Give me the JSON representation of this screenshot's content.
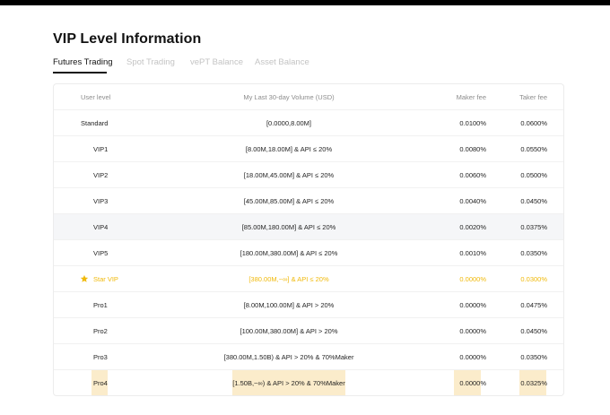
{
  "page": {
    "title": "VIP Level Information"
  },
  "tabs": [
    {
      "label": "Futures Trading",
      "active": true
    },
    {
      "label": "Spot Trading",
      "active": false
    },
    {
      "label": "vePT Balance",
      "active": false
    },
    {
      "label": "Asset Balance",
      "active": false
    }
  ],
  "table": {
    "headers": {
      "level": "User level",
      "volume": "My Last 30-day Volume (USD)",
      "maker": "Maker fee",
      "taker": "Taker fee"
    },
    "rows": [
      {
        "level": "Standard",
        "volume": "[0.0000,8.00M]",
        "maker": "0.0100%",
        "taker": "0.0600%"
      },
      {
        "level": "VIP1",
        "volume": "[8.00M,18.00M] & API ≤ 20%",
        "maker": "0.0080%",
        "taker": "0.0550%"
      },
      {
        "level": "VIP2",
        "volume": "[18.00M,45.00M] & API ≤ 20%",
        "maker": "0.0060%",
        "taker": "0.0500%"
      },
      {
        "level": "VIP3",
        "volume": "[45.00M,85.00M] & API ≤ 20%",
        "maker": "0.0040%",
        "taker": "0.0450%"
      },
      {
        "level": "VIP4",
        "volume": "[85.00M,180.00M] & API ≤ 20%",
        "maker": "0.0020%",
        "taker": "0.0375%"
      },
      {
        "level": "VIP5",
        "volume": "[180.00M,380.00M] & API ≤ 20%",
        "maker": "0.0010%",
        "taker": "0.0350%"
      },
      {
        "level": "Star VIP",
        "volume": "[380.00M,~∞] & API ≤ 20%",
        "maker": "0.0000%",
        "taker": "0.0300%"
      },
      {
        "level": "Pro1",
        "volume": "[8.00M,100.00M] & API > 20%",
        "maker": "0.0000%",
        "taker": "0.0475%"
      },
      {
        "level": "Pro2",
        "volume": "[100.00M,380.00M] & API > 20%",
        "maker": "0.0000%",
        "taker": "0.0450%"
      },
      {
        "level": "Pro3",
        "volume": "[380.00M,1.50B) & API > 20% & 70%Maker",
        "maker": "0.0000%",
        "taker": "0.0350%"
      },
      {
        "level": "Pro4",
        "volume": "[1.50B,~∞) & API > 20% & 70%Maker",
        "maker": "0.0000%",
        "taker": "0.0325%"
      }
    ]
  },
  "colors": {
    "accent_gold": "#f0b90b",
    "highlight_bg": "#fbeccb",
    "hover_row_bg": "#f5f6f8",
    "topbar": "#000000"
  },
  "icons": {
    "star_vip": "star-icon"
  }
}
